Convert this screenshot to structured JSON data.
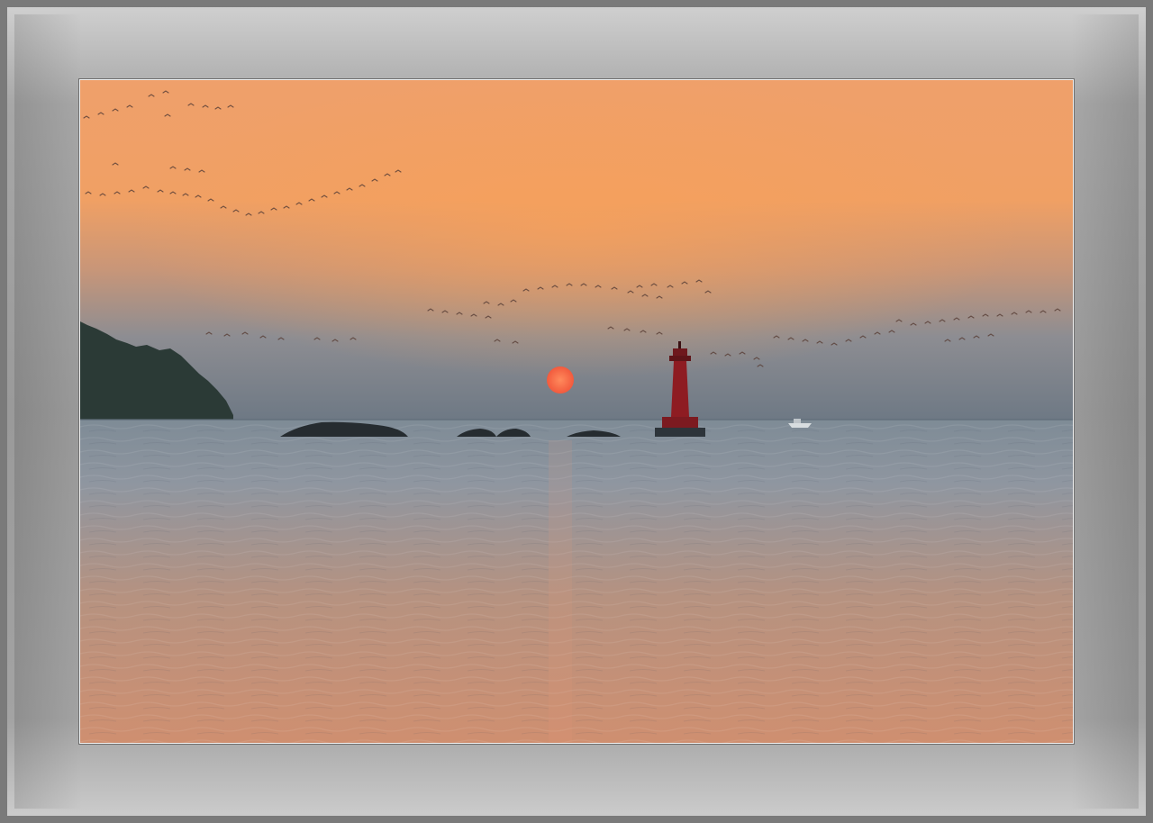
{
  "scene": {
    "subject": "lighthouse-at-sunset",
    "colors": {
      "sky_top": "#f1a66f",
      "sky_mid": "#f29f63",
      "sky_low": "#8a8a8f",
      "sky_horizon": "#6f7a86",
      "sun": "#ff6a4a",
      "lighthouse": "#8e1c22",
      "sea_far": "#7f8d99",
      "sea_mid": "#b5907d",
      "sea_near": "#d3906e",
      "land": "#2b3a34",
      "rock": "#2a2f33",
      "frame": "#9b9b9b"
    }
  }
}
